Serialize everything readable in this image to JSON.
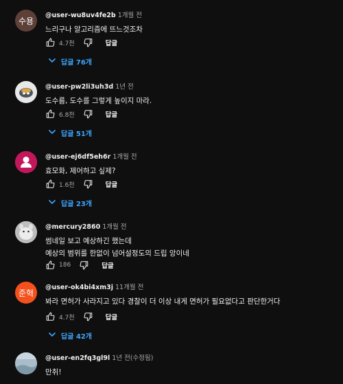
{
  "comments": [
    {
      "author": "@user-wu8uv4fe2b",
      "time": "1개월 전",
      "lines": [
        "느리구나 알고리즘에 뜨느것조차"
      ],
      "likes": "4.7천",
      "reply_label": "답글",
      "replies_label": "답글 76개",
      "avatar_text": "수용",
      "avatar_color": "#5d4037"
    },
    {
      "author": "@user-pw2li3uh3d",
      "time": "1년 전",
      "lines": [
        "도수름, 도수를 그렇게 높이지 마라."
      ],
      "likes": "6.8천",
      "reply_label": "답글",
      "replies_label": "답글 51개",
      "avatar_text": "",
      "avatar_color": "#e8e8e8"
    },
    {
      "author": "@user-ej6df5eh6r",
      "time": "1개월 전",
      "lines": [
        "효모화, 제어하고 싶제?"
      ],
      "likes": "1.6천",
      "reply_label": "답글",
      "replies_label": "답글 23개",
      "avatar_text": "",
      "avatar_color": "#c2185b"
    },
    {
      "author": "@mercury2860",
      "time": "1개월 전",
      "lines": [
        "썸네일 보고 예상하긴 했는데",
        "예상의 범위를 한없이 넘어설정도의 드립 앙이네"
      ],
      "likes": "186",
      "reply_label": "답글",
      "replies_label": "",
      "avatar_text": "",
      "avatar_color": "#cfcfcf"
    },
    {
      "author": "@user-ok4bi4xm3j",
      "time": "11개월 전",
      "lines": [
        "봐라 면허가 사라지고 있다 경찰이 더 이상 내게 면허가 필요없다고 판단한거다"
      ],
      "likes": "4.7천",
      "reply_label": "답글",
      "replies_label": "답글 42개",
      "avatar_text": "준혁",
      "avatar_color": "#f4511e"
    },
    {
      "author": "@user-en2fq3gl9l",
      "time": "1년 전(수정됨)",
      "lines": [
        "만취!"
      ],
      "likes": "",
      "reply_label": "",
      "replies_label": "",
      "avatar_text": "",
      "avatar_color": "#9fb4c4"
    }
  ]
}
